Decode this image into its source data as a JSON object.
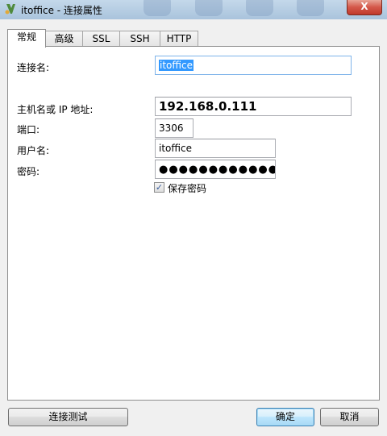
{
  "window": {
    "title": "itoffice - 连接属性",
    "close_glyph": "X"
  },
  "tabs": [
    {
      "label": "常规",
      "active": true
    },
    {
      "label": "高级",
      "active": false
    },
    {
      "label": "SSL",
      "active": false
    },
    {
      "label": "SSH",
      "active": false
    },
    {
      "label": "HTTP",
      "active": false
    }
  ],
  "form": {
    "connection_name_label": "连接名:",
    "connection_name_value": "itoffice",
    "host_label": "主机名或 IP 地址:",
    "host_value": "192.168.0.111",
    "port_label": "端口:",
    "port_value": "3306",
    "username_label": "用户名:",
    "username_value": "itoffice",
    "password_label": "密码:",
    "password_value": "●●●●●●●●●●●●●●",
    "save_password_label": "保存密码",
    "save_password_checked": true
  },
  "buttons": {
    "test_connection": "连接测试",
    "ok": "确定",
    "cancel": "取消"
  },
  "colors": {
    "selection": "#3399ff",
    "titlebar": "#b8cfe4",
    "close": "#c0392b"
  }
}
